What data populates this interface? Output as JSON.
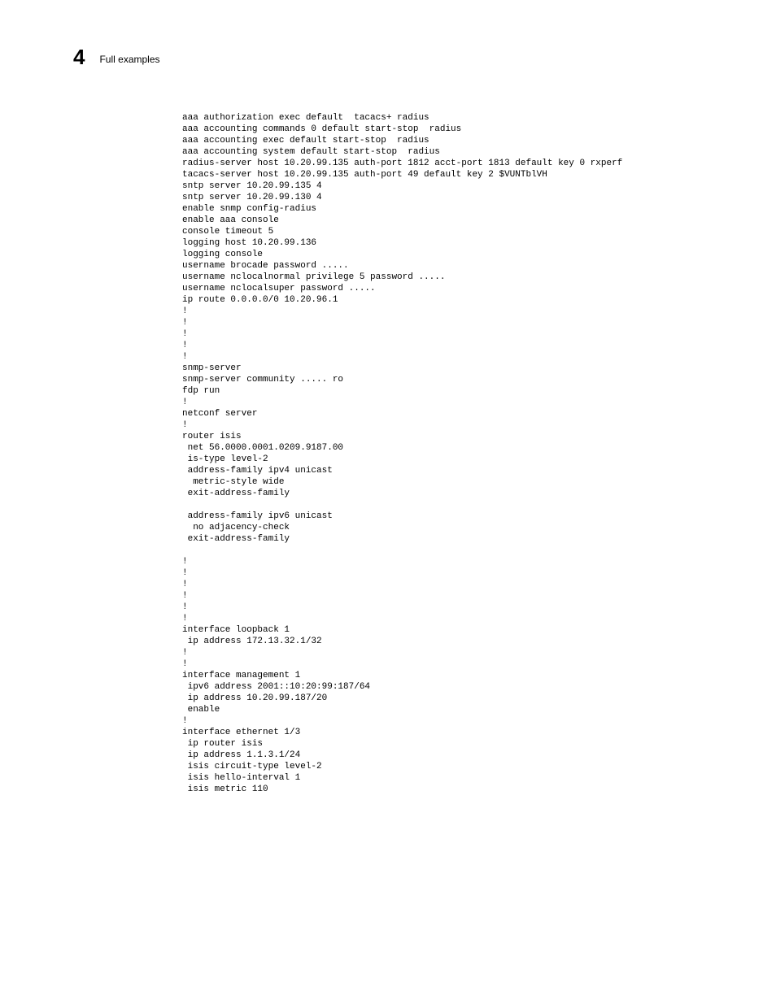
{
  "header": {
    "chapter_number": "4",
    "section_title": "Full examples"
  },
  "code": {
    "lines": [
      "aaa authorization exec default  tacacs+ radius",
      "aaa accounting commands 0 default start-stop  radius",
      "aaa accounting exec default start-stop  radius",
      "aaa accounting system default start-stop  radius",
      "radius-server host 10.20.99.135 auth-port 1812 acct-port 1813 default key 0 rxperf",
      "tacacs-server host 10.20.99.135 auth-port 49 default key 2 $VUNTblVH",
      "sntp server 10.20.99.135 4",
      "sntp server 10.20.99.130 4",
      "enable snmp config-radius",
      "enable aaa console",
      "console timeout 5",
      "logging host 10.20.99.136",
      "logging console",
      "username brocade password .....",
      "username nclocalnormal privilege 5 password .....",
      "username nclocalsuper password .....",
      "ip route 0.0.0.0/0 10.20.96.1",
      "!",
      "!",
      "!",
      "!",
      "!",
      "snmp-server",
      "snmp-server community ..... ro",
      "fdp run",
      "!",
      "netconf server",
      "!",
      "router isis",
      " net 56.0000.0001.0209.9187.00",
      " is-type level-2",
      " address-family ipv4 unicast",
      "  metric-style wide",
      " exit-address-family",
      "",
      " address-family ipv6 unicast",
      "  no adjacency-check",
      " exit-address-family",
      "",
      "!",
      "!",
      "!",
      "!",
      "!",
      "!",
      "interface loopback 1",
      " ip address 172.13.32.1/32",
      "!",
      "!",
      "interface management 1",
      " ipv6 address 2001::10:20:99:187/64",
      " ip address 10.20.99.187/20",
      " enable",
      "!",
      "interface ethernet 1/3",
      " ip router isis",
      " ip address 1.1.3.1/24",
      " isis circuit-type level-2",
      " isis hello-interval 1",
      " isis metric 110"
    ]
  }
}
